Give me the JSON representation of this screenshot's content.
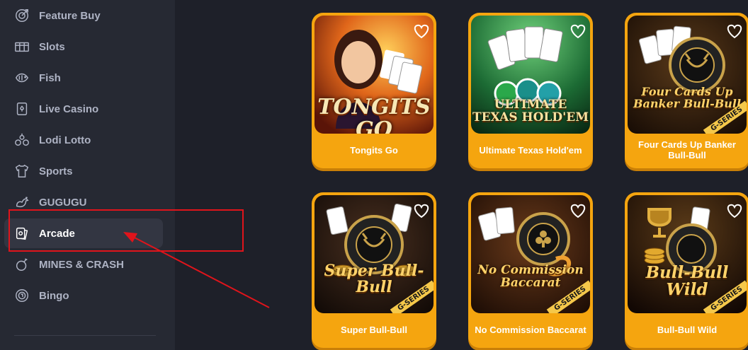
{
  "sidebar": {
    "items": [
      {
        "label": "Feature Buy",
        "icon": "target-icon"
      },
      {
        "label": "Slots",
        "icon": "slot-machine-icon"
      },
      {
        "label": "Fish",
        "icon": "fish-icon"
      },
      {
        "label": "Live Casino",
        "icon": "playing-card-icon"
      },
      {
        "label": "Lodi Lotto",
        "icon": "lottery-balls-icon"
      },
      {
        "label": "Sports",
        "icon": "jersey-icon"
      },
      {
        "label": "GUGUGU",
        "icon": "rooster-icon"
      },
      {
        "label": "Arcade",
        "icon": "cards-icon",
        "active": true
      },
      {
        "label": "MINES & CRASH",
        "icon": "bomb-icon"
      },
      {
        "label": "Bingo",
        "icon": "bingo-ball-icon"
      }
    ]
  },
  "games": [
    {
      "name": "Tongits Go",
      "art_title": "TONGITS GO"
    },
    {
      "name": "Ultimate Texas Hold'em",
      "art_title": "ULTIMATE TEXAS HOLD'EM"
    },
    {
      "name": "Four Cards Up Banker Bull-Bull",
      "art_title": "Four Cards Up Banker Bull-Bull",
      "badge": "G-SERIES"
    },
    {
      "name": "Super Bull-Bull",
      "art_title": "Super Bull-Bull",
      "badge": "G-SERIES"
    },
    {
      "name": "No Commission Baccarat",
      "art_title": "No Commission Baccarat",
      "badge": "G-SERIES"
    },
    {
      "name": "Bull-Bull Wild",
      "art_title": "Bull-Bull Wild",
      "badge": "G-SERIES"
    }
  ],
  "colors": {
    "background": "#1e2029",
    "sidebar": "#262933",
    "card": "#f5a50f",
    "annotation": "#e0141b"
  }
}
